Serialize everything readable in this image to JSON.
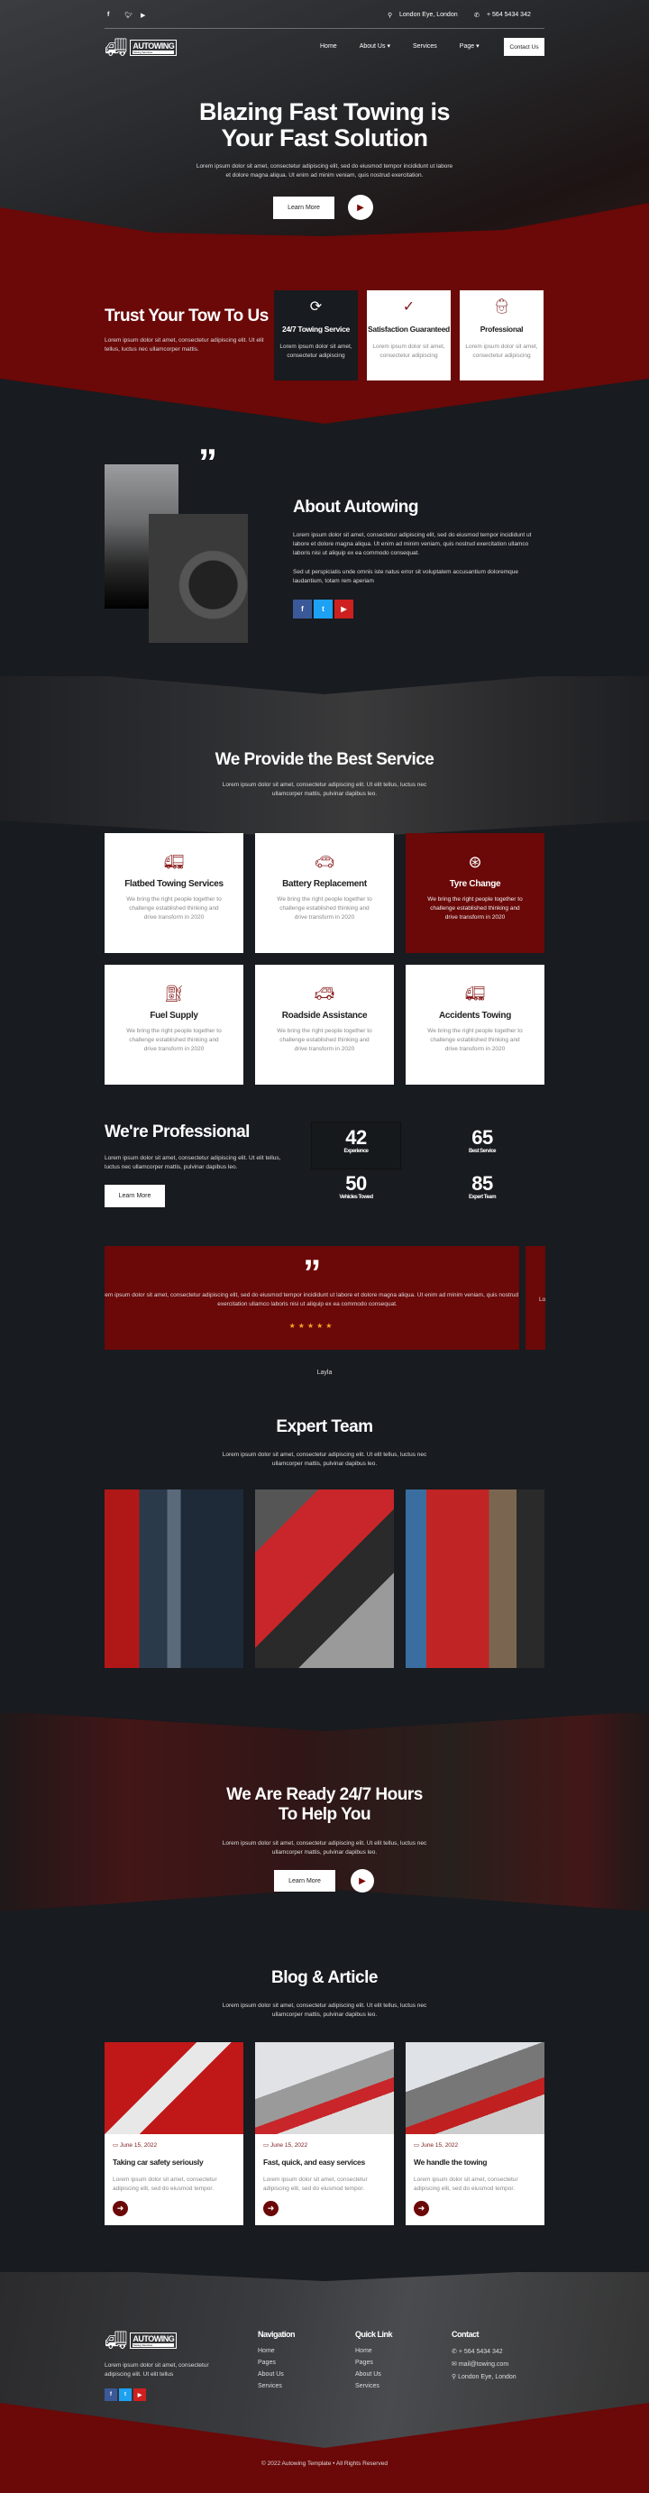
{
  "topbar": {
    "location": "London Eye, London",
    "phone": "+ 564 5434 342"
  },
  "logo": {
    "name": "AUTOWING",
    "tagline": "Towing Services"
  },
  "nav": {
    "items": [
      "Home",
      "About Us",
      "Services",
      "Page"
    ],
    "contact": "Contact Us"
  },
  "hero": {
    "title1": "Blazing Fast Towing is",
    "title2": "Your Fast Solution",
    "text": "Lorem ipsum dolor sit amet, consectetur adipiscing elit, sed do eiusmod tempor incididunt ut labore et dolore magna aliqua. Ut enim ad minim veniam, quis nostrud exercitation.",
    "cta": "Learn More"
  },
  "trust": {
    "title": "Trust Your Tow To Us",
    "text": "Lorem ipsum dolor sit amet, consectetur adipiscing elit. Ut elit tellus, luctus nec ullamcorper mattis.",
    "cards": [
      {
        "title": "24/7 Towing Service",
        "text": "Lorem ipsum dolor sit amet, consectetur adipiscing",
        "icon": "24-hour-icon"
      },
      {
        "title": "Satisfaction Guaranteed",
        "text": "Lorem ipsum dolor sit amet, consectetur adipiscing",
        "icon": "check-badge-icon"
      },
      {
        "title": "Professional",
        "text": "Lorem ipsum dolor sit amet, consectetur adipiscing",
        "icon": "worker-icon"
      }
    ]
  },
  "about": {
    "title": "About Autowing",
    "p1": "Lorem ipsum dolor sit amet, consectetur adipiscing elit, sed do eiusmod tempor incididunt ut labore et dolore magna aliqua. Ut enim ad minim veniam, quis nostrud exercitation ullamco laboris nisi ut aliquip ex ea commodo consequat.",
    "p2": "Sed ut perspiciatis unde omnis iste natus error sit voluptatem accusantium doloremque laudantium, totam rem aperiam"
  },
  "services": {
    "title": "We Provide the Best Service",
    "text": "Lorem ipsum dolor sit amet, consectetur adipiscing elit. Ut elit tellus, luctus nec ullamcorper mattis, pulvinar dapibus leo.",
    "items": [
      {
        "title": "Flatbed Towing Services",
        "text": "We bring the right people together to challenge established thinking and drive transform in 2020",
        "icon": "tow-truck-icon"
      },
      {
        "title": "Battery Replacement",
        "text": "We bring the right people together to challenge established thinking and drive transform in 2020",
        "icon": "car-battery-icon"
      },
      {
        "title": "Tyre Change",
        "text": "We bring the right people together to challenge established thinking and drive transform in 2020",
        "icon": "tyre-icon"
      },
      {
        "title": "Fuel Supply",
        "text": "We bring the right people together to challenge established thinking and drive transform in 2020",
        "icon": "fuel-pump-icon"
      },
      {
        "title": "Roadside Assistance",
        "text": "We bring the right people together to challenge established thinking and drive transform in 2020",
        "icon": "car-jack-icon"
      },
      {
        "title": "Accidents Towing",
        "text": "We bring the right people together to challenge established thinking and drive transform in 2020",
        "icon": "tow-truck-icon"
      }
    ]
  },
  "pro": {
    "title": "We're Professional",
    "text": "Lorem ipsum dolor sit amet, consectetur adipiscing elit. Ut elit tellus, luctus nec ullamcorper mattis, pulvinar dapibus leo.",
    "cta": "Learn More",
    "stats": [
      {
        "value": "42",
        "label": "Experience"
      },
      {
        "value": "65",
        "label": "Best Service"
      },
      {
        "value": "50",
        "label": "Vehicles Towed"
      },
      {
        "value": "85",
        "label": "Expert Team"
      }
    ]
  },
  "testimonial": {
    "text": "Lorem ipsum dolor sit amet, consectetur adipiscing elit, sed do eiusmod tempor incididunt ut labore et dolore magna aliqua. Ut enim ad minim veniam, quis nostrud exercitation ullamco laboris nisi ut aliquip ex ea commodo consequat.",
    "rating": 5,
    "stars": "★★★★★",
    "name": "Layla",
    "next_peek": "Lo"
  },
  "team": {
    "title": "Expert Team",
    "text": "Lorem ipsum dolor sit amet, consectetur adipiscing elit. Ut elit tellus, luctus nec ullamcorper mattis, pulvinar dapibus leo."
  },
  "cta": {
    "title1": "We Are Ready 24/7 Hours",
    "title2": "To Help You",
    "text": "Lorem ipsum dolor sit amet, consectetur adipiscing elit. Ut elit tellus, luctus nec ullamcorper mattis, pulvinar dapibus leo.",
    "button": "Learn More"
  },
  "blog": {
    "title": "Blog & Article",
    "text": "Lorem ipsum dolor sit amet, consectetur adipiscing elit. Ut elit tellus, luctus nec ullamcorper mattis, pulvinar dapibus leo.",
    "posts": [
      {
        "date": "June 15, 2022",
        "title": "Taking car safety seriously",
        "text": "Lorem ipsum dolor sit amet, consectetur adipiscing elit, sed do eiusmod tempor."
      },
      {
        "date": "June 15, 2022",
        "title": "Fast, quick, and easy services",
        "text": "Lorem ipsum dolor sit amet, consectetur adipiscing elit, sed do eiusmod tempor."
      },
      {
        "date": "June 15, 2022",
        "title": "We handle the towing",
        "text": "Lorem ipsum dolor sit amet, consectetur adipiscing elit, sed do eiusmod tempor."
      }
    ]
  },
  "footer": {
    "text": "Lorem ipsum dolor sit amet, consectetur adipiscing elit. Ut elit tellus",
    "nav_title": "Navigation",
    "nav": [
      "Home",
      "Pages",
      "About Us",
      "Services"
    ],
    "quick_title": "Quick Link",
    "quick": [
      "Home",
      "Pages",
      "About Us",
      "Services"
    ],
    "contact_title": "Contact",
    "phone": "+ 564 5434 342",
    "email": "mail@towing.com",
    "address": "London Eye, London",
    "copyright": "© 2022 Autowing Template • All Rights Reserved"
  },
  "colors": {
    "brand_red": "#6b0808",
    "dark": "#181b1f",
    "facebook": "#3b5998",
    "twitter": "#1da1f2",
    "youtube": "#cd201f",
    "star": "#f5a623"
  }
}
